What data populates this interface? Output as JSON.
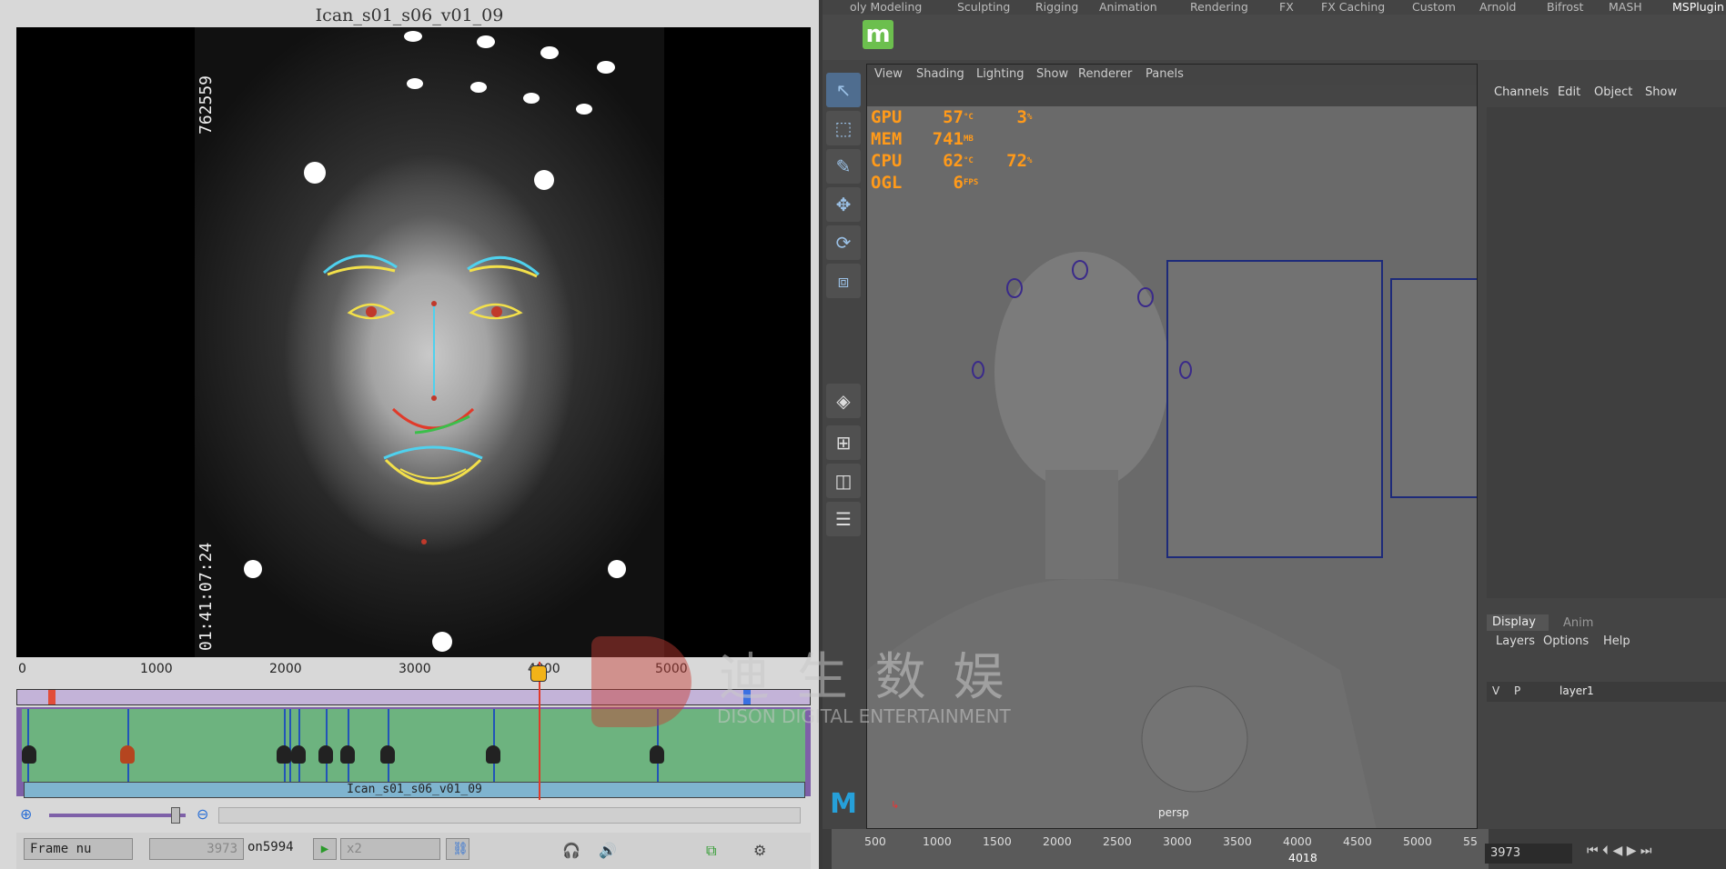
{
  "clip_viewer": {
    "clip_title": "Ican_s01_s06_v01_09",
    "timecode_top": "762559",
    "timecode_bottom": "01:41:07:24",
    "ruler_ticks": [
      "0",
      "1000",
      "2000",
      "3000",
      "4000",
      "5000"
    ],
    "clip_name": "Ican_s01_s06_v01_09",
    "frame_mode": "Frame nu",
    "frame_value": "3973",
    "frame_total": "on5994",
    "speed": "x2"
  },
  "maya": {
    "shelf_tabs": [
      "oly Modeling",
      "Sculpting",
      "Rigging",
      "Animation",
      "Rendering",
      "FX",
      "FX Caching",
      "Custom",
      "Arnold",
      "Bifrost",
      "MASH",
      "MSPlugin"
    ],
    "viewport_menu": [
      "View",
      "Shading",
      "Lighting",
      "Show",
      "Renderer",
      "Panels"
    ],
    "hud": [
      {
        "label": "GPU",
        "v1": "57",
        "u1": "°C",
        "v2": "3",
        "u2": "%"
      },
      {
        "label": "MEM",
        "v1": "741",
        "u1": "MB",
        "v2": "",
        "u2": ""
      },
      {
        "label": "CPU",
        "v1": "62",
        "u1": "°C",
        "v2": "72",
        "u2": "%"
      },
      {
        "label": "OGL",
        "v1": "6",
        "u1": "FPS",
        "v2": "",
        "u2": ""
      }
    ],
    "camera_label": "persp",
    "channel_menu": [
      "Channels",
      "Edit",
      "Object",
      "Show"
    ],
    "layer_tabs": [
      "Display",
      "Anim"
    ],
    "layer_menu": [
      "Layers",
      "Options",
      "Help"
    ],
    "layer": {
      "v": "V",
      "p": "P",
      "name": "layer1"
    },
    "timeline_ticks": [
      "500",
      "1000",
      "1500",
      "2000",
      "2500",
      "3000",
      "3500",
      "4000",
      "4500",
      "5000",
      "55"
    ],
    "current_frame_marker": "4018",
    "current_frame_field": "3973"
  },
  "watermark": {
    "cn": "迪 生 数 娱",
    "en": "DISON DIGITAL ENTERTAINMENT"
  }
}
